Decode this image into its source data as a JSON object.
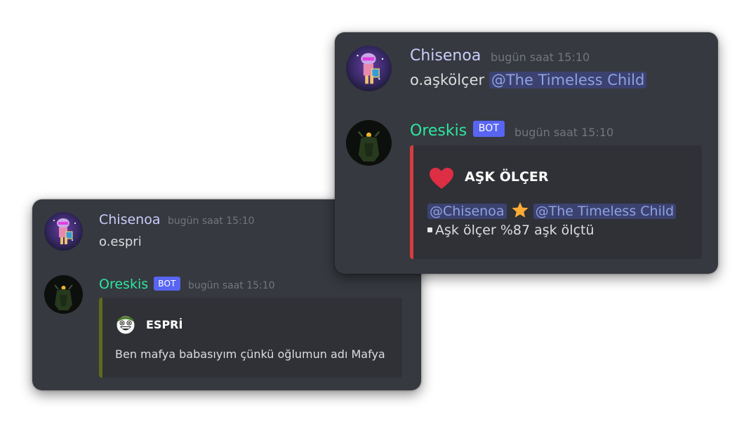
{
  "left_window": {
    "user_message": {
      "username": "Chisenoa",
      "timestamp": "bugün saat 15:10",
      "text": "o.espri"
    },
    "bot_message": {
      "username": "Oreskis",
      "bot_tag": "BOT",
      "timestamp": "bugün saat 15:10",
      "embed": {
        "accent_color": "#5e6b1a",
        "icon": "laughing-face-icon",
        "title": "ESPRİ",
        "description": "Ben mafya babasıyım çünkü oğlumun adı Mafya"
      }
    }
  },
  "right_window": {
    "user_message": {
      "username": "Chisenoa",
      "timestamp": "bugün saat 15:10",
      "command": "o.aşkölçer",
      "mention": "@The Timeless Child"
    },
    "bot_message": {
      "username": "Oreskis",
      "bot_tag": "BOT",
      "timestamp": "bugün saat 15:10",
      "embed": {
        "accent_color": "#d83c3e",
        "icon": "heart-icon",
        "title": "AŞK ÖLÇER",
        "mention_a": "@Chisenoa",
        "separator_icon": "star-icon",
        "mention_b": "@The Timeless Child",
        "result": "Aşk ölçer %87 aşk ölçtü"
      }
    }
  },
  "colors": {
    "background": "#36393f",
    "user_name": "#c9cdfb",
    "bot_name": "#2ee6a0",
    "bot_tag": "#5865f2",
    "mention_text": "#8ea1e1"
  }
}
